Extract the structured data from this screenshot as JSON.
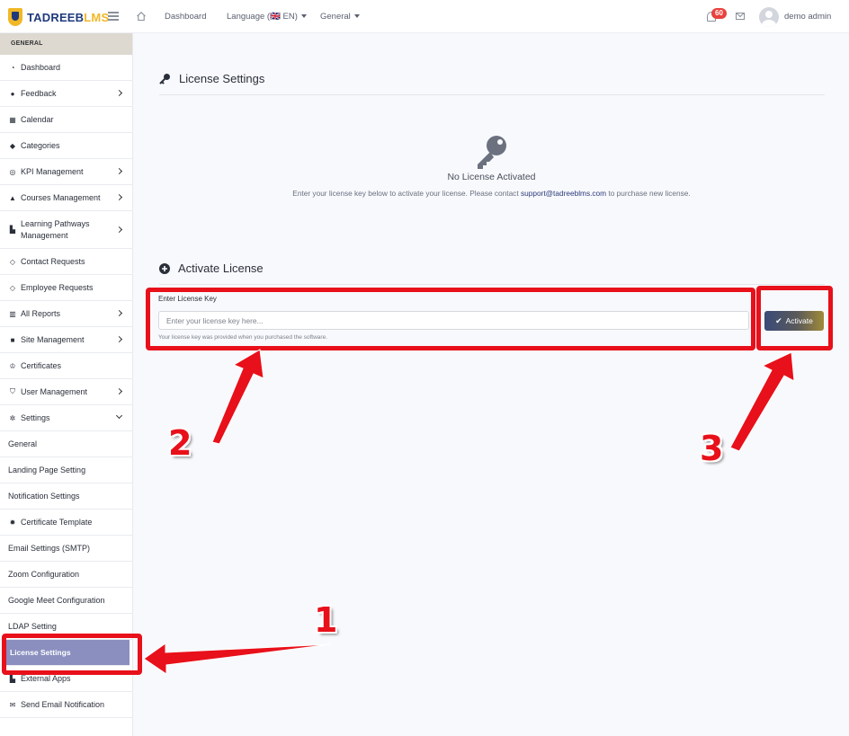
{
  "brand": {
    "logo_main": "TADREEB",
    "logo_accent": "LMS"
  },
  "topbar": {
    "dashboard": "Dashboard",
    "language": "Language (🇬🇧 EN)",
    "general": "General",
    "notification_count": "60",
    "user_name": "demo admin"
  },
  "sidebar": {
    "section": "GENERAL",
    "items": [
      {
        "label": "Dashboard",
        "icon": "dashboard-icon"
      },
      {
        "label": "Feedback",
        "icon": "chat-icon"
      },
      {
        "label": "Calendar",
        "icon": "calendar-icon"
      },
      {
        "label": "Categories",
        "icon": "tags-icon"
      },
      {
        "label": "KPI Management",
        "icon": "target-icon"
      },
      {
        "label": "Courses Management",
        "icon": "graduation-cap-icon"
      },
      {
        "label": "Learning Pathways Management",
        "icon": "sitemap-icon"
      },
      {
        "label": "Contact Requests",
        "icon": "tag-icon"
      },
      {
        "label": "Employee Requests",
        "icon": "tag-icon"
      },
      {
        "label": "All Reports",
        "icon": "chart-icon"
      },
      {
        "label": "Site Management",
        "icon": "folder-icon"
      },
      {
        "label": "Certificates",
        "icon": "trophy-icon"
      },
      {
        "label": "User Management",
        "icon": "shield-icon"
      },
      {
        "label": "Settings",
        "icon": "gear-icon"
      },
      {
        "label": "General"
      },
      {
        "label": "Landing Page Setting"
      },
      {
        "label": "Notification Settings"
      },
      {
        "label": "Certificate Template",
        "icon": "badge-icon"
      },
      {
        "label": "Email Settings (SMTP)"
      },
      {
        "label": "Zoom Configuration"
      },
      {
        "label": "Google Meet Configuration"
      },
      {
        "label": "LDAP Setting"
      },
      {
        "label": "License Settings"
      },
      {
        "label": "External Apps",
        "icon": "sitemap-icon"
      },
      {
        "label": "Send Email Notification",
        "icon": "envelope-icon"
      }
    ]
  },
  "license": {
    "title": "License Settings",
    "empty_title": "No License Activated",
    "empty_desc_pre": "Enter your license key below to activate your license. Please contact ",
    "empty_desc_email": "support@tadreeblms.com",
    "empty_desc_post": " to purchase new license."
  },
  "activate": {
    "title": "Activate License",
    "field_label": "Enter License Key",
    "placeholder": "Enter your license key here...",
    "help": "Your license key was provided when you purchased the software.",
    "button": "Activate"
  },
  "annotations": {
    "one": "1",
    "two": "2",
    "three": "3"
  },
  "colors": {
    "annotation": "#e8101a",
    "active_nav": "#8a8fbf",
    "brand_blue": "#1e3a7b",
    "brand_gold": "#f1b826"
  }
}
